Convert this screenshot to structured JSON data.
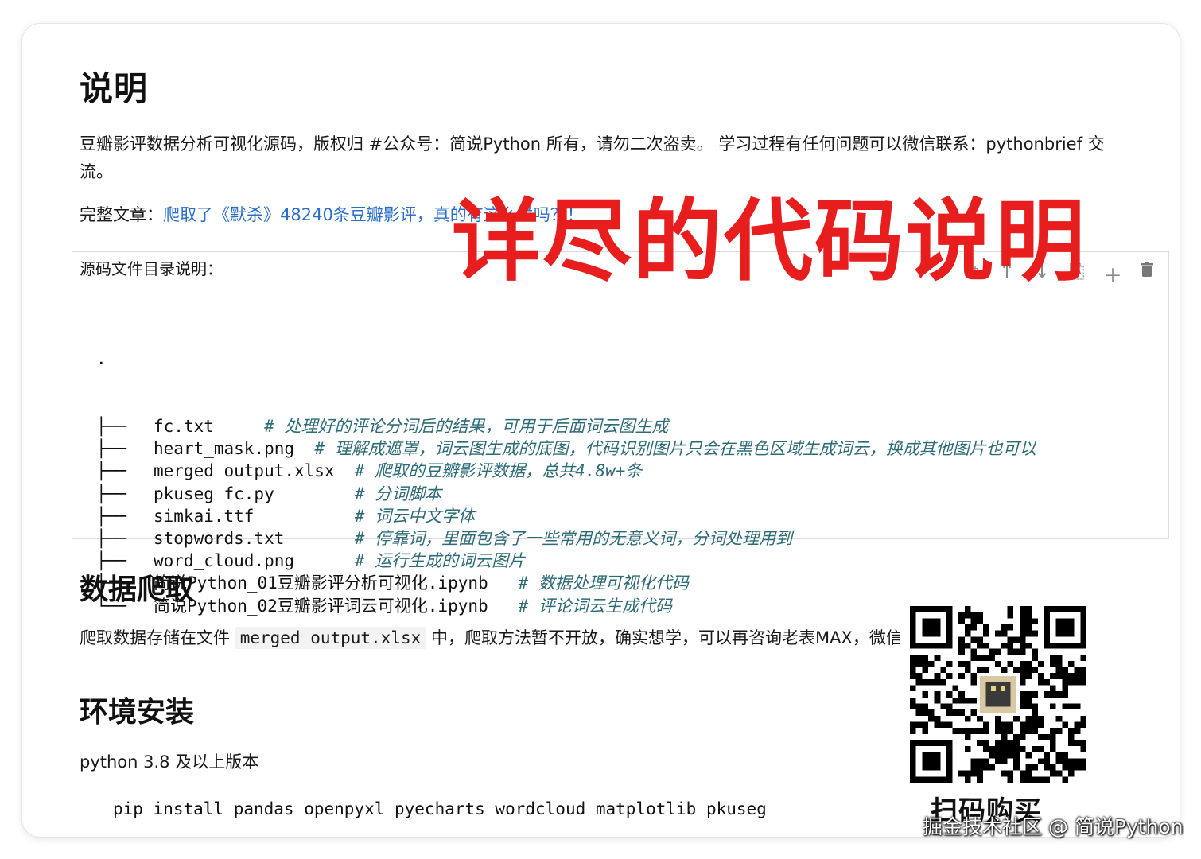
{
  "section1": {
    "title": "说明",
    "intro": "豆瓣影评数据分析可视化源码，版权归 #公众号：简说Python 所有，请勿二次盗卖。 学习过程有任何问题可以微信联系：pythonbrief 交流。",
    "article_prefix": "完整文章：",
    "article_link": "爬取了《默杀》48240条豆瓣影评，真的有这么烂吗？！"
  },
  "code_cell": {
    "title": "源码文件目录说明：",
    "root": ".",
    "toolbar_icons": [
      "copy-icon",
      "move-up-icon",
      "move-down-icon",
      "duplicate-icon",
      "add-icon",
      "delete-icon"
    ],
    "files": [
      {
        "branch": "├──",
        "name": "fc.txt",
        "pad": "     ",
        "comment": "# 处理好的评论分词后的结果，可用于后面词云图生成"
      },
      {
        "branch": "├──",
        "name": "heart_mask.png",
        "pad": "  ",
        "comment": "# 理解成遮罩，词云图生成的底图，代码识别图片只会在黑色区域生成词云，换成其他图片也可以"
      },
      {
        "branch": "├──",
        "name": "merged_output.xlsx",
        "pad": "  ",
        "comment": "# 爬取的豆瓣影评数据，总共4.8w+条"
      },
      {
        "branch": "├──",
        "name": "pkuseg_fc.py",
        "pad": "        ",
        "comment": "# 分词脚本"
      },
      {
        "branch": "├──",
        "name": "simkai.ttf",
        "pad": "          ",
        "comment": "# 词云中文字体"
      },
      {
        "branch": "├──",
        "name": "stopwords.txt",
        "pad": "       ",
        "comment": "# 停靠词，里面包含了一些常用的无意义词，分词处理用到"
      },
      {
        "branch": "├──",
        "name": "word_cloud.png",
        "pad": "      ",
        "comment": "# 运行生成的词云图片"
      },
      {
        "branch": "├──",
        "name": "简说Python_01豆瓣影评分析可视化.ipynb",
        "pad": "   ",
        "comment": "# 数据处理可视化代码"
      },
      {
        "branch": "└──",
        "name": "简说Python_02豆瓣影评词云可视化.ipynb",
        "pad": "   ",
        "comment": "# 评论词云生成代码"
      }
    ]
  },
  "overlay_text": "详尽的代码说明",
  "section2": {
    "title": "数据爬取",
    "text_before": "爬取数据存储在文件",
    "code": "merged_output.xlsx",
    "text_after": "中，爬取方法暂不开放，确实想学，可以再咨询老表MAX，微信"
  },
  "section3": {
    "title": "环境安装",
    "version_text": "python 3.8 及以上版本",
    "pip_command": "pip install pandas openpyxl pyecharts wordcloud matplotlib pkuseg"
  },
  "qr": {
    "label": "扫码购买"
  },
  "watermark": "掘金技术社区 @ 简说Python",
  "colors": {
    "link": "#2a6fc9",
    "comment": "#2d6b77",
    "overlay": "#e81d1d"
  }
}
